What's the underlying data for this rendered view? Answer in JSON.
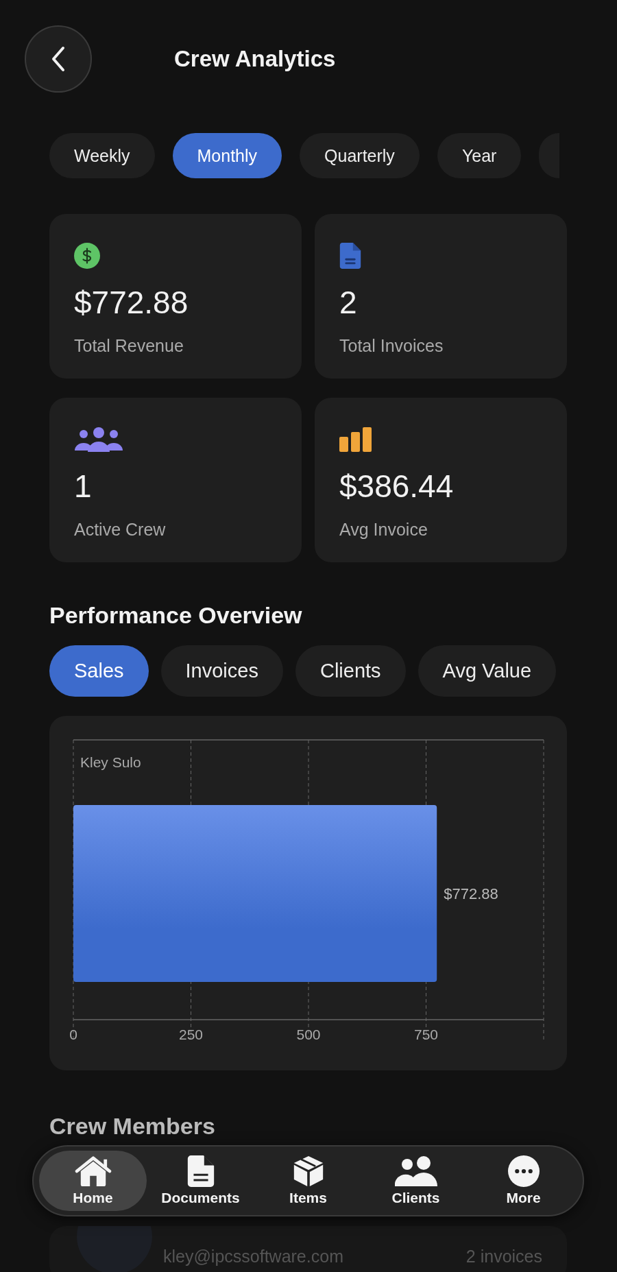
{
  "header": {
    "title": "Crew Analytics"
  },
  "periods": [
    {
      "label": "Weekly",
      "selected": false
    },
    {
      "label": "Monthly",
      "selected": true
    },
    {
      "label": "Quarterly",
      "selected": false
    },
    {
      "label": "Year",
      "selected": false
    }
  ],
  "stats": [
    {
      "kind": "revenue",
      "value": "$772.88",
      "label": "Total Revenue"
    },
    {
      "kind": "invoices",
      "value": "2",
      "label": "Total Invoices"
    },
    {
      "kind": "crew",
      "value": "1",
      "label": "Active Crew"
    },
    {
      "kind": "average",
      "value": "$386.44",
      "label": "Avg Invoice"
    }
  ],
  "performance": {
    "title": "Performance Overview",
    "metrics": [
      {
        "label": "Sales",
        "selected": true
      },
      {
        "label": "Invoices",
        "selected": false
      },
      {
        "label": "Clients",
        "selected": false
      },
      {
        "label": "Avg Value",
        "selected": false
      }
    ],
    "chart_data": {
      "type": "bar",
      "orientation": "horizontal",
      "categories": [
        "Kley Sulo"
      ],
      "series": [
        {
          "color": "#3d6bcc",
          "values": [
            772.88
          ]
        }
      ],
      "xlim": [
        0,
        1000
      ],
      "grid": true,
      "xticks": [
        0,
        250,
        500,
        750
      ],
      "value_labels": [
        "$772.88"
      ]
    }
  },
  "crew": {
    "title": "Crew Members",
    "members": [
      {
        "email": "kley@ipcssoftware.com",
        "invoices": "2 invoices"
      }
    ]
  },
  "nav": [
    {
      "kind": "home",
      "label": "Home",
      "selected": true
    },
    {
      "kind": "documents",
      "label": "Documents",
      "selected": false
    },
    {
      "kind": "items",
      "label": "Items",
      "selected": false
    },
    {
      "kind": "clients",
      "label": "Clients",
      "selected": false
    },
    {
      "kind": "more",
      "label": "More",
      "selected": false
    }
  ]
}
